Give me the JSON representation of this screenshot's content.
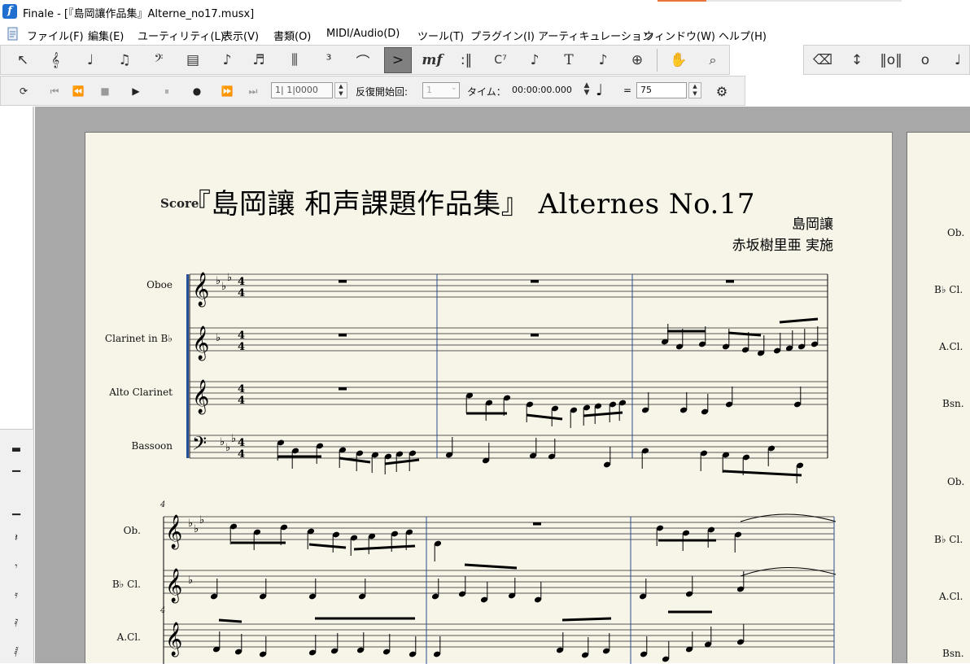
{
  "window": {
    "title": "Finale - [『島岡讓作品集』Alterne_no17.musx]",
    "app_icon": "f"
  },
  "menu": [
    "ファイル(F)",
    "編集(E)",
    "ユーティリティ(L)",
    "表示(V)",
    "書類(O)",
    "MIDI/Audio(D)",
    "ツール(T)",
    "プラグイン(I)",
    "アーティキュレーション",
    "ウィンドウ(W)",
    "ヘルプ(H)"
  ],
  "toolbar": {
    "tools": [
      {
        "name": "selection-tool-icon",
        "glyph": "↖"
      },
      {
        "name": "staff-tool-icon",
        "glyph": "𝄞"
      },
      {
        "name": "simple-entry-icon",
        "glyph": "♩"
      },
      {
        "name": "speedy-entry-icon",
        "glyph": "♫"
      },
      {
        "name": "clef-tool-icon",
        "glyph": "𝄢"
      },
      {
        "name": "measure-tool-icon",
        "glyph": "▤"
      },
      {
        "name": "note-tool-icon",
        "glyph": "♪"
      },
      {
        "name": "grace-tool-icon",
        "glyph": "♬"
      },
      {
        "name": "staff-styles-icon",
        "glyph": "⫼"
      },
      {
        "name": "tuplet-tool-icon",
        "glyph": "³"
      },
      {
        "name": "smart-shape-icon",
        "glyph": "⌒"
      },
      {
        "name": "articulation-tool-icon",
        "glyph": ">"
      },
      {
        "name": "expression-tool-icon",
        "glyph": "mf"
      },
      {
        "name": "repeat-tool-icon",
        "glyph": ":‖"
      },
      {
        "name": "chord-tool-icon",
        "glyph": "C⁷"
      },
      {
        "name": "lyrics-tool-icon",
        "glyph": "♪"
      },
      {
        "name": "text-tool-icon",
        "glyph": "T"
      },
      {
        "name": "resize-tool-icon",
        "glyph": "♪"
      },
      {
        "name": "page-layout-icon",
        "glyph": "⊕"
      },
      {
        "name": "hand-grabber-icon",
        "glyph": "✋"
      },
      {
        "name": "zoom-icon",
        "glyph": "🔍"
      }
    ],
    "right_tools": [
      {
        "name": "eraser-icon",
        "glyph": "⌫"
      },
      {
        "name": "move-up-down-icon",
        "glyph": "↕"
      },
      {
        "name": "breve-icon",
        "glyph": "𝅜"
      },
      {
        "name": "whole-note-icon",
        "glyph": "𝅝"
      },
      {
        "name": "half-note-icon",
        "glyph": "𝅗𝅥"
      }
    ]
  },
  "playback": {
    "position": "1| 1|0000",
    "repeat_label": "反復開始回:",
    "repeat_value": "1",
    "time_label": "タイム：",
    "time_value": "00:00:00.000",
    "equals": "=",
    "tempo": "75"
  },
  "score": {
    "score_label": "Score",
    "title": "『島岡讓 和声課題作品集』 Alternes No.17",
    "composer": "島岡讓",
    "arranger": "赤坂樹里亜 実施",
    "instruments_full": [
      "Oboe",
      "Clarinet in B♭",
      "Alto Clarinet",
      "Bassoon"
    ],
    "instruments_short": [
      "Ob.",
      "B♭ Cl.",
      "A.Cl."
    ],
    "measure_number": "4",
    "measure_number_small": "4",
    "time_signature": "4/4"
  },
  "next_page": {
    "instruments": [
      "Ob.",
      "B♭ Cl.",
      "A.Cl.",
      "Bsn.",
      "Ob.",
      "B♭ Cl.",
      "A.Cl.",
      "Bsn."
    ]
  }
}
